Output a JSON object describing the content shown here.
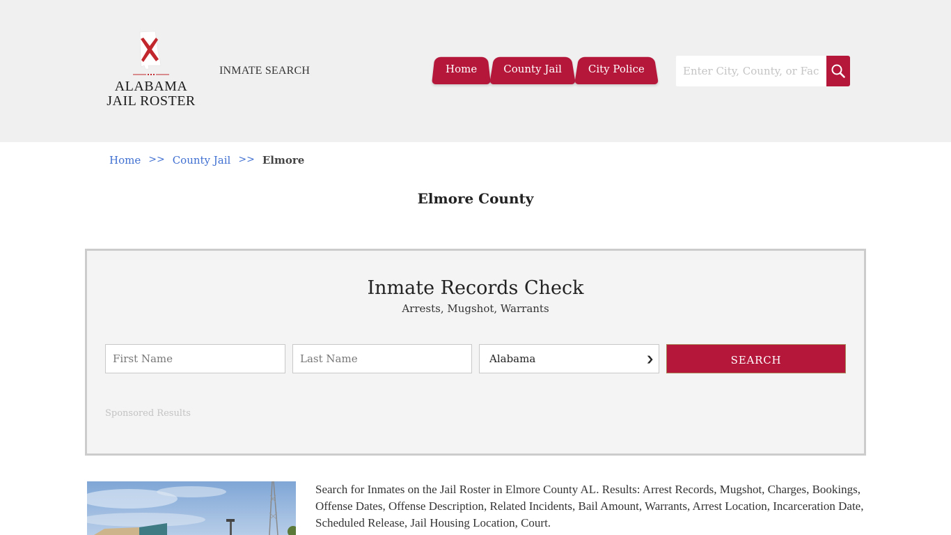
{
  "header": {
    "logo_text_line1": "ALABAMA",
    "logo_text_line2": "JAIL ROSTER",
    "inmate_search_link": "INMATE SEARCH",
    "nav": [
      {
        "label": "Home"
      },
      {
        "label": "County Jail"
      },
      {
        "label": "City Police"
      }
    ],
    "search": {
      "placeholder": "Enter City, County, or Facility",
      "value": "",
      "button_icon": "search-icon"
    }
  },
  "breadcrumb": {
    "items": [
      {
        "label": "Home"
      },
      {
        "label": "County Jail"
      }
    ],
    "separator": ">>",
    "current": "Elmore"
  },
  "page_title": "Elmore County",
  "records_panel": {
    "title": "Inmate Records Check",
    "subtitle": "Arrests, Mugshot, Warrants",
    "first_name_placeholder": "First Name",
    "last_name_placeholder": "Last Name",
    "state_selected": "Alabama",
    "search_label": "SEARCH",
    "sponsored_label": "Sponsored Results"
  },
  "content": {
    "description": "Search for Inmates on the Jail Roster in Elmore County AL. Results: Arrest Records, Mugshot, Charges, Bookings, Offense Dates, Offense Description, Related Incidents, Bail Amount, Warrants, Arrest Location, Incarceration Date, Scheduled Release, Jail Housing Location, Court."
  },
  "colors": {
    "brand_red": "#b5173b",
    "header_bg": "#f0f0f0",
    "link_blue": "#3f6fd1",
    "panel_bg": "#f4f4f4"
  }
}
